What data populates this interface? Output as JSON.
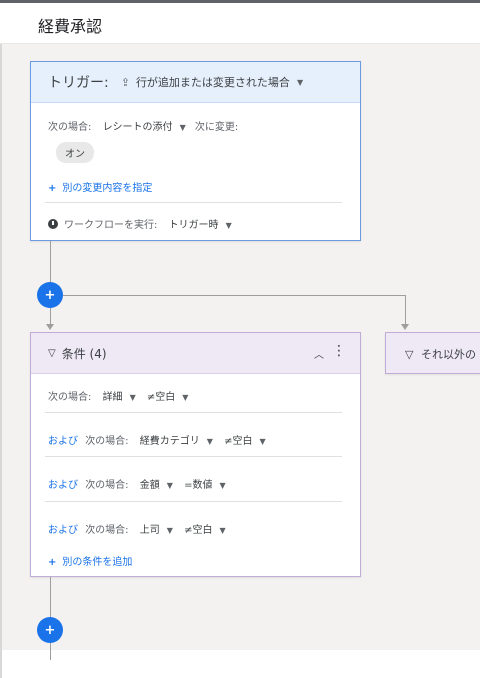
{
  "header": {
    "title": "経費承認"
  },
  "trigger": {
    "label": "トリガー:",
    "icon": "upload-icon",
    "value": "行が追加または変更された場合",
    "if_label": "次の場合:",
    "if_value": "レシートの添付",
    "change_label": "次に変更:",
    "change_value": "オン",
    "add_change_label": "別の変更内容を指定",
    "run_label": "ワークフローを実行:",
    "run_value": "トリガー時"
  },
  "condition": {
    "title": "条件 (4)",
    "rows": [
      {
        "prefix": "",
        "label": "次の場合:",
        "field": "詳細",
        "op": "≠空白"
      },
      {
        "prefix": "および",
        "label": "次の場合:",
        "field": "経費カテゴリ",
        "op": "≠空白"
      },
      {
        "prefix": "および",
        "label": "次の場合:",
        "field": "金額",
        "op": "=数値"
      },
      {
        "prefix": "および",
        "label": "次の場合:",
        "field": "上司",
        "op": "≠空白"
      }
    ],
    "add_label": "別の条件を追加"
  },
  "else_branch": {
    "title": "それ以外の"
  },
  "add_button": {
    "label": "+"
  },
  "colors": {
    "accent": "#1a73e8",
    "trigger_bg": "#e6f0fc",
    "condition_bg": "#efe8f5"
  }
}
